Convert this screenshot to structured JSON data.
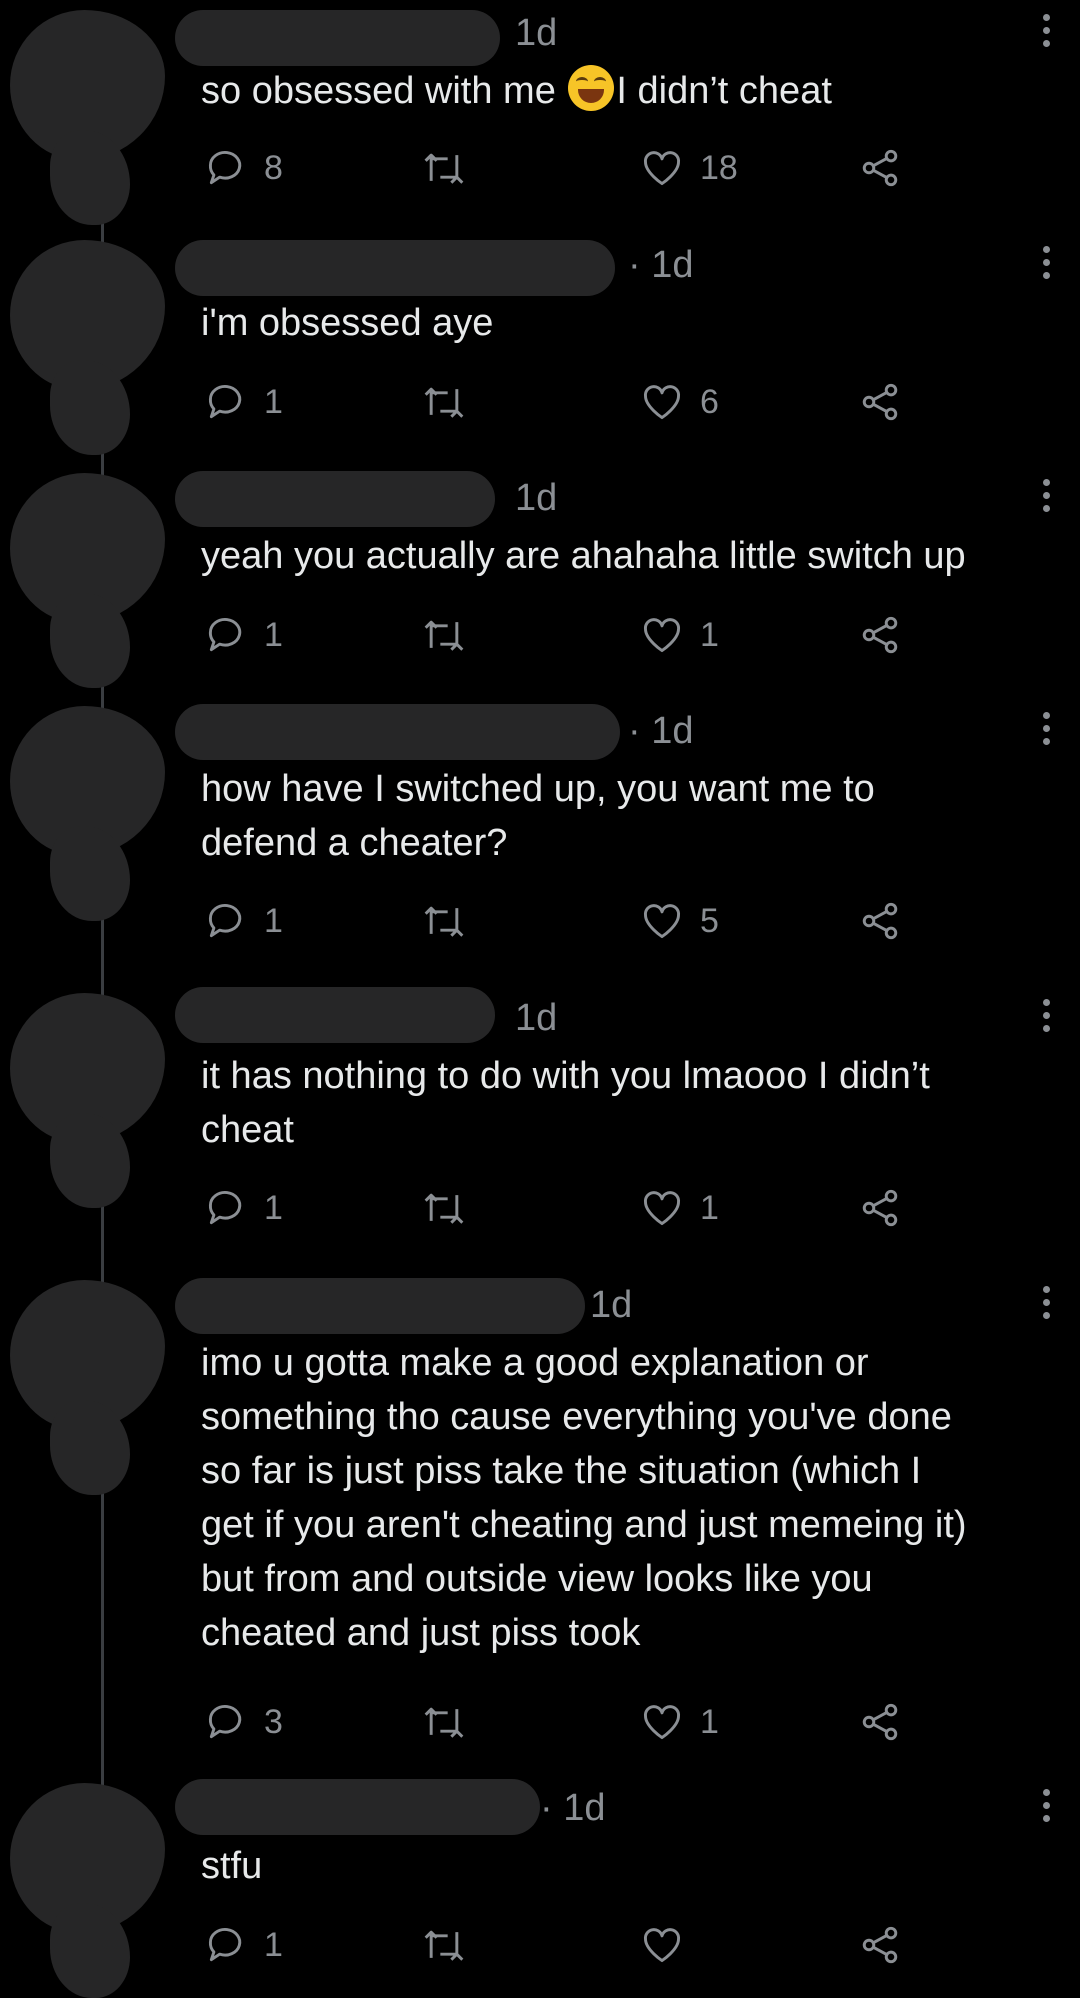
{
  "thread": [
    {
      "time": "1d",
      "text_before": "so obsessed with me ",
      "emoji": "face-with-tears-of-joy",
      "text_after": "I didn’t cheat",
      "replies": "8",
      "likes": "18"
    },
    {
      "time": "· 1d",
      "text": "i'm obsessed aye",
      "replies": "1",
      "likes": "6"
    },
    {
      "time": "1d",
      "text": "yeah you actually are ahahaha little switch up",
      "replies": "1",
      "likes": "1"
    },
    {
      "time": "· 1d",
      "text": "how have I switched up, you want me to\ndefend a cheater?",
      "replies": "1",
      "likes": "5"
    },
    {
      "time": "1d",
      "text": "it has nothing to do with you lmaooo I didn’t\ncheat",
      "replies": "1",
      "likes": "1"
    },
    {
      "time": "1d",
      "text": "imo u gotta make a good explanation or\nsomething tho cause everything you've done\nso far is just piss take the situation (which I\nget if you aren't cheating and just memeing it)\nbut from and outside view looks like you\ncheated and just piss took",
      "replies": "3",
      "likes": "1"
    },
    {
      "time": "· 1d",
      "text": "stfu",
      "replies": "1",
      "likes": ""
    }
  ],
  "icons": {
    "reply": "reply-icon",
    "retweet": "retweet-icon",
    "like": "heart-icon",
    "share": "share-icon",
    "more": "more-vertical-icon"
  },
  "colors": {
    "background": "#000000",
    "text": "#e7e9ea",
    "muted": "#8b8f94",
    "redaction": "#262627"
  }
}
